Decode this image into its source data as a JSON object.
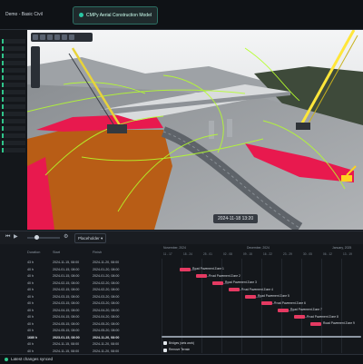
{
  "tabs": [
    {
      "label": "Demo - Basic Civil"
    },
    {
      "label": "CMPy Aerial Construction Model"
    }
  ],
  "viewport": {
    "date": "2024-11-18 13:20"
  },
  "playback": {
    "view_dropdown": "Placeholder"
  },
  "grid": {
    "columns": [
      "",
      "Duration",
      "Start",
      "Finish"
    ],
    "rows": [
      {
        "id": "",
        "duration": "43 h",
        "start": "2024-11-15, 08:00",
        "finish": "2024-11-20, 08:00"
      },
      {
        "id": "",
        "duration": "40 h",
        "start": "2024-01-15, 08:00",
        "finish": "2024-01-20, 08:00"
      },
      {
        "id": "",
        "duration": "40 h",
        "start": "2024-01-15, 08:00",
        "finish": "2024-01-20, 08:00"
      },
      {
        "id": "",
        "duration": "40 h",
        "start": "2024-02-15, 08:00",
        "finish": "2024-02-20, 08:00"
      },
      {
        "id": "",
        "duration": "40 h",
        "start": "2024-02-15, 08:00",
        "finish": "2024-02-20, 08:00"
      },
      {
        "id": "",
        "duration": "40 h",
        "start": "2024-03-15, 08:00",
        "finish": "2024-03-20, 08:00"
      },
      {
        "id": "",
        "duration": "40 h",
        "start": "2024-03-15, 08:00",
        "finish": "2024-03-20, 08:00"
      },
      {
        "id": "",
        "duration": "40 h",
        "start": "2024-04-15, 08:00",
        "finish": "2024-04-20, 08:00"
      },
      {
        "id": "",
        "duration": "40 h",
        "start": "2024-04-15, 08:00",
        "finish": "2024-04-20, 08:00"
      },
      {
        "id": "",
        "duration": "40 h",
        "start": "2024-05-15, 08:00",
        "finish": "2024-05-20, 08:00"
      },
      {
        "id": "",
        "duration": "40 h",
        "start": "2024-05-15, 08:00",
        "finish": "2024-05-20, 08:00"
      },
      {
        "id": "",
        "duration": "1680 h",
        "start": "2023-01-15, 08:00",
        "finish": "2024-11-20, 08:00",
        "bold": true
      },
      {
        "id": "",
        "duration": "40 h",
        "start": "2024-11-15, 08:00",
        "finish": "2024-11-20, 08:00"
      },
      {
        "id": "",
        "duration": "40 h",
        "start": "2024-11-15, 08:00",
        "finish": "2024-11-20, 08:00"
      }
    ]
  },
  "gantt": {
    "months": [
      "November, 2024",
      "December, 2024",
      "January, 2025"
    ],
    "weeks": [
      "11 - 17",
      "18 - 24",
      "25 - 01",
      "02 - 08",
      "09 - 15",
      "16 - 22",
      "23 - 29",
      "30 - 05",
      "06 - 12",
      "13 - 19"
    ],
    "tasks": [
      {
        "label": "Road Pavement Zone 1",
        "row": 1
      },
      {
        "label": "Road Pavement Zone 2",
        "row": 2
      },
      {
        "label": "Road Pavement Zone 3",
        "row": 3
      },
      {
        "label": "Road Pavement Zone 4",
        "row": 4
      },
      {
        "label": "Road Pavement Zone 5",
        "row": 5
      },
      {
        "label": "Road Pavement Zone 6",
        "row": 6
      },
      {
        "label": "Road Pavement Zone 7",
        "row": 7
      },
      {
        "label": "Road Pavement Zone 8",
        "row": 8
      },
      {
        "label": "Road Pavement Zone 9",
        "row": 9
      }
    ],
    "summary_labels": [
      "Bridges (sets work)",
      "Remove Terrain"
    ]
  },
  "status": {
    "text": "Latest changes synced",
    "color": "#2fc58a"
  },
  "colors": {
    "accent": "#29c7a4",
    "bar": "#e53a62",
    "zone": "#e8194e",
    "excavation": "#b85d16",
    "crane": "#ffe63a",
    "alignment": "#b5ff2b"
  }
}
